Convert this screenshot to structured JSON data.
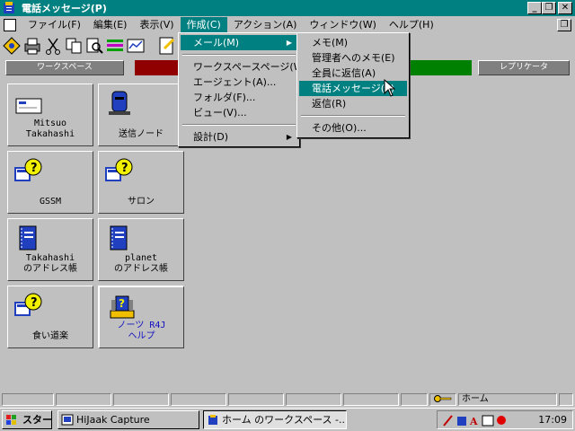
{
  "window": {
    "title": "電話メッセージ(P)"
  },
  "menubar": {
    "items": [
      "ファイル(F)",
      "編集(E)",
      "表示(V)",
      "作成(C)",
      "アクション(A)",
      "ウィンドウ(W)",
      "ヘルプ(H)"
    ],
    "active_index": 3
  },
  "tabs": {
    "workspace_label": "ワークスペース",
    "replicator_label": "レプリケータ"
  },
  "tiles": [
    {
      "label": "Mitsuo\nTakahashi",
      "icon": "envelope-icon"
    },
    {
      "label": "送信ノード",
      "icon": "mailbox-icon"
    },
    {
      "label": "GSSM",
      "icon": "database-question-icon"
    },
    {
      "label": "サロン",
      "icon": "database-question-icon"
    },
    {
      "label": "Takahashi\nのアドレス帳",
      "icon": "address-book-icon"
    },
    {
      "label": "planet\nのアドレス帳",
      "icon": "address-book-icon"
    },
    {
      "label": "食い道楽",
      "icon": "database-question-icon"
    },
    {
      "label": "ノーツ R4J\nヘルプ",
      "icon": "help-icon"
    }
  ],
  "create_menu": {
    "items": [
      "メール(M)",
      "ワークスペースページ(W)",
      "エージェント(A)...",
      "フォルダ(F)...",
      "ビュー(V)...",
      "設計(D)"
    ],
    "highlighted_index": 0
  },
  "mail_submenu": {
    "items": [
      "メモ(M)",
      "管理者へのメモ(E)",
      "全員に返信(A)",
      "電話メッセージ(P)",
      "返信(R)",
      "その他(O)..."
    ],
    "highlighted_index": 3
  },
  "statusbar": {
    "location": "ホーム"
  },
  "taskbar": {
    "start_label": "スタート",
    "tasks": [
      "HiJaak Capture",
      "ホーム のワークスペース -..."
    ],
    "clock": "17:09"
  },
  "colors": {
    "accent": "#008080",
    "desktop": "#c0c0c0"
  }
}
